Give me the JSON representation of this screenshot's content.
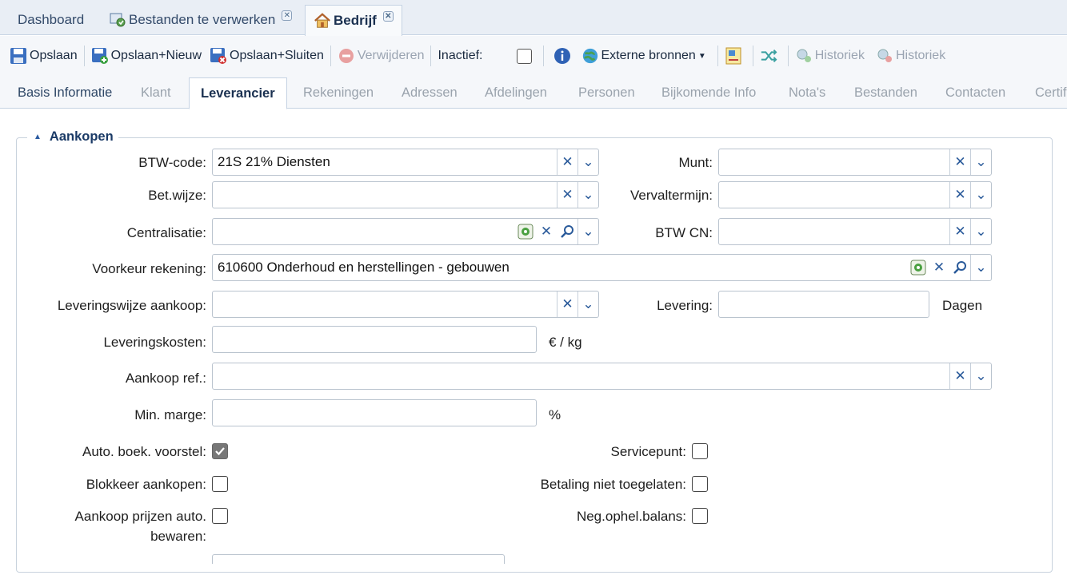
{
  "doc_tabs": [
    {
      "label": "Dashboard"
    },
    {
      "label": "Bestanden te verwerken"
    },
    {
      "label": "Bedrijf"
    }
  ],
  "toolbar": {
    "save": "Opslaan",
    "save_new": "Opslaan+Nieuw",
    "save_close": "Opslaan+Sluiten",
    "delete": "Verwijderen",
    "inactive": "Inactief:",
    "external": "Externe bronnen",
    "history1": "Historiek",
    "history2": "Historiek"
  },
  "sub_tabs": [
    {
      "label": "Basis Informatie"
    },
    {
      "label": "Klant"
    },
    {
      "label": "Leverancier"
    },
    {
      "label": "Rekeningen"
    },
    {
      "label": "Adressen"
    },
    {
      "label": "Afdelingen"
    },
    {
      "label": "Personen"
    },
    {
      "label": "Bijkomende Info"
    },
    {
      "label": "Nota's"
    },
    {
      "label": "Bestanden"
    },
    {
      "label": "Contacten"
    },
    {
      "label": "Certif"
    }
  ],
  "section": {
    "title": "Aankopen"
  },
  "fields": {
    "btw_code": {
      "label": "BTW-code:",
      "value": "21S 21% Diensten"
    },
    "munt": {
      "label": "Munt:",
      "value": ""
    },
    "betwijze": {
      "label": "Bet.wijze:",
      "value": ""
    },
    "vervaltermijn": {
      "label": "Vervaltermijn:",
      "value": ""
    },
    "centralisatie": {
      "label": "Centralisatie:",
      "value": ""
    },
    "btw_cn": {
      "label": "BTW CN:",
      "value": ""
    },
    "voorkeur_rekening": {
      "label": "Voorkeur rekening:",
      "value": "610600 Onderhoud en herstellingen - gebouwen"
    },
    "leveringswijze": {
      "label": "Leveringswijze aankoop:",
      "value": ""
    },
    "levering": {
      "label": "Levering:",
      "value": "",
      "unit": "Dagen"
    },
    "leveringskosten": {
      "label": "Leveringskosten:",
      "value": "",
      "unit": "€ / kg"
    },
    "aankoop_ref": {
      "label": "Aankoop ref.:",
      "value": ""
    },
    "min_marge": {
      "label": "Min. marge:",
      "value": "",
      "unit": "%"
    }
  },
  "checkboxes": {
    "auto_boek": {
      "label": "Auto. boek. voorstel:",
      "checked": true
    },
    "blokkeer": {
      "label": "Blokkeer aankopen:",
      "checked": false
    },
    "prijzen_line1": "Aankoop prijzen auto.",
    "prijzen_line2": "bewaren:",
    "prijzen_checked": false,
    "servicepunt": {
      "label": "Servicepunt:",
      "checked": false
    },
    "betaling": {
      "label": "Betaling niet toegelaten:",
      "checked": false
    },
    "negophel": {
      "label": "Neg.ophel.balans:",
      "checked": false
    },
    "inactief_checked": false
  },
  "colors": {
    "accent": "#2a5a9a",
    "tab_bg": "#e9eef5",
    "border": "#b9c3ce"
  }
}
